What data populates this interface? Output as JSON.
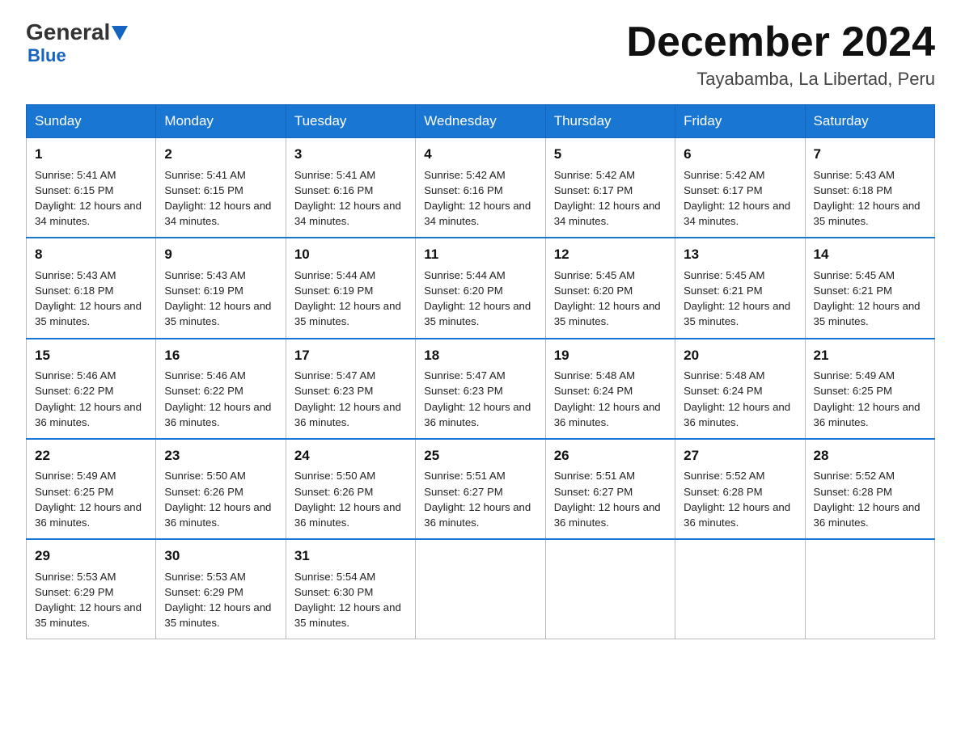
{
  "logo": {
    "general": "General",
    "triangle": "",
    "blue": "Blue"
  },
  "title": "December 2024",
  "subtitle": "Tayabamba, La Libertad, Peru",
  "days_of_week": [
    "Sunday",
    "Monday",
    "Tuesday",
    "Wednesday",
    "Thursday",
    "Friday",
    "Saturday"
  ],
  "weeks": [
    [
      {
        "num": "1",
        "sunrise": "5:41 AM",
        "sunset": "6:15 PM",
        "daylight": "12 hours and 34 minutes."
      },
      {
        "num": "2",
        "sunrise": "5:41 AM",
        "sunset": "6:15 PM",
        "daylight": "12 hours and 34 minutes."
      },
      {
        "num": "3",
        "sunrise": "5:41 AM",
        "sunset": "6:16 PM",
        "daylight": "12 hours and 34 minutes."
      },
      {
        "num": "4",
        "sunrise": "5:42 AM",
        "sunset": "6:16 PM",
        "daylight": "12 hours and 34 minutes."
      },
      {
        "num": "5",
        "sunrise": "5:42 AM",
        "sunset": "6:17 PM",
        "daylight": "12 hours and 34 minutes."
      },
      {
        "num": "6",
        "sunrise": "5:42 AM",
        "sunset": "6:17 PM",
        "daylight": "12 hours and 34 minutes."
      },
      {
        "num": "7",
        "sunrise": "5:43 AM",
        "sunset": "6:18 PM",
        "daylight": "12 hours and 35 minutes."
      }
    ],
    [
      {
        "num": "8",
        "sunrise": "5:43 AM",
        "sunset": "6:18 PM",
        "daylight": "12 hours and 35 minutes."
      },
      {
        "num": "9",
        "sunrise": "5:43 AM",
        "sunset": "6:19 PM",
        "daylight": "12 hours and 35 minutes."
      },
      {
        "num": "10",
        "sunrise": "5:44 AM",
        "sunset": "6:19 PM",
        "daylight": "12 hours and 35 minutes."
      },
      {
        "num": "11",
        "sunrise": "5:44 AM",
        "sunset": "6:20 PM",
        "daylight": "12 hours and 35 minutes."
      },
      {
        "num": "12",
        "sunrise": "5:45 AM",
        "sunset": "6:20 PM",
        "daylight": "12 hours and 35 minutes."
      },
      {
        "num": "13",
        "sunrise": "5:45 AM",
        "sunset": "6:21 PM",
        "daylight": "12 hours and 35 minutes."
      },
      {
        "num": "14",
        "sunrise": "5:45 AM",
        "sunset": "6:21 PM",
        "daylight": "12 hours and 35 minutes."
      }
    ],
    [
      {
        "num": "15",
        "sunrise": "5:46 AM",
        "sunset": "6:22 PM",
        "daylight": "12 hours and 36 minutes."
      },
      {
        "num": "16",
        "sunrise": "5:46 AM",
        "sunset": "6:22 PM",
        "daylight": "12 hours and 36 minutes."
      },
      {
        "num": "17",
        "sunrise": "5:47 AM",
        "sunset": "6:23 PM",
        "daylight": "12 hours and 36 minutes."
      },
      {
        "num": "18",
        "sunrise": "5:47 AM",
        "sunset": "6:23 PM",
        "daylight": "12 hours and 36 minutes."
      },
      {
        "num": "19",
        "sunrise": "5:48 AM",
        "sunset": "6:24 PM",
        "daylight": "12 hours and 36 minutes."
      },
      {
        "num": "20",
        "sunrise": "5:48 AM",
        "sunset": "6:24 PM",
        "daylight": "12 hours and 36 minutes."
      },
      {
        "num": "21",
        "sunrise": "5:49 AM",
        "sunset": "6:25 PM",
        "daylight": "12 hours and 36 minutes."
      }
    ],
    [
      {
        "num": "22",
        "sunrise": "5:49 AM",
        "sunset": "6:25 PM",
        "daylight": "12 hours and 36 minutes."
      },
      {
        "num": "23",
        "sunrise": "5:50 AM",
        "sunset": "6:26 PM",
        "daylight": "12 hours and 36 minutes."
      },
      {
        "num": "24",
        "sunrise": "5:50 AM",
        "sunset": "6:26 PM",
        "daylight": "12 hours and 36 minutes."
      },
      {
        "num": "25",
        "sunrise": "5:51 AM",
        "sunset": "6:27 PM",
        "daylight": "12 hours and 36 minutes."
      },
      {
        "num": "26",
        "sunrise": "5:51 AM",
        "sunset": "6:27 PM",
        "daylight": "12 hours and 36 minutes."
      },
      {
        "num": "27",
        "sunrise": "5:52 AM",
        "sunset": "6:28 PM",
        "daylight": "12 hours and 36 minutes."
      },
      {
        "num": "28",
        "sunrise": "5:52 AM",
        "sunset": "6:28 PM",
        "daylight": "12 hours and 36 minutes."
      }
    ],
    [
      {
        "num": "29",
        "sunrise": "5:53 AM",
        "sunset": "6:29 PM",
        "daylight": "12 hours and 35 minutes."
      },
      {
        "num": "30",
        "sunrise": "5:53 AM",
        "sunset": "6:29 PM",
        "daylight": "12 hours and 35 minutes."
      },
      {
        "num": "31",
        "sunrise": "5:54 AM",
        "sunset": "6:30 PM",
        "daylight": "12 hours and 35 minutes."
      },
      null,
      null,
      null,
      null
    ]
  ],
  "labels": {
    "sunrise": "Sunrise:",
    "sunset": "Sunset:",
    "daylight": "Daylight:"
  }
}
